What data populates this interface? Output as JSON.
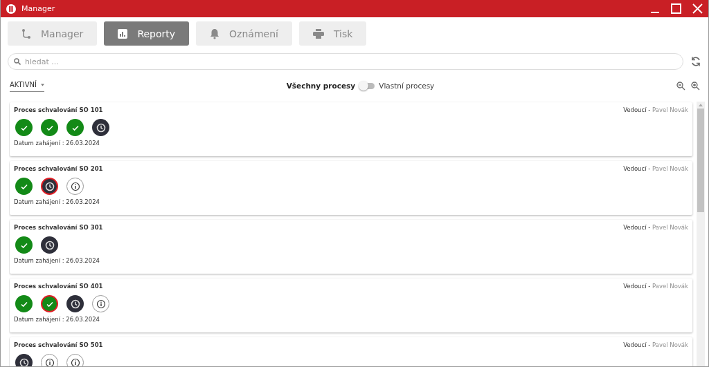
{
  "window": {
    "title": "Manager"
  },
  "tabs": [
    {
      "label": "Manager",
      "selected": false
    },
    {
      "label": "Reporty",
      "selected": true
    },
    {
      "label": "Oznámení",
      "selected": false
    },
    {
      "label": "Tisk",
      "selected": false
    }
  ],
  "search": {
    "placeholder": "hledat ..."
  },
  "filter": {
    "value": "AKTIVNÍ"
  },
  "scope_toggle": {
    "left_label": "Všechny procesy",
    "right_label": "Vlastní procesy",
    "on": false
  },
  "processes": [
    {
      "title": "Proces schvalování SO 101",
      "role": "Vedoucí - ",
      "person": "Pavel Novák",
      "date": "Datum zahájení : 26.03.2024",
      "steps": [
        {
          "kind": "done"
        },
        {
          "kind": "done"
        },
        {
          "kind": "done"
        },
        {
          "kind": "pending"
        }
      ]
    },
    {
      "title": "Proces schvalování SO 201",
      "role": "Vedoucí - ",
      "person": "Pavel Novák",
      "date": "Datum zahájení : 26.03.2024",
      "steps": [
        {
          "kind": "done"
        },
        {
          "kind": "pending-alert"
        },
        {
          "kind": "info"
        }
      ]
    },
    {
      "title": "Proces schvalování SO 301",
      "role": "Vedoucí - ",
      "person": "Pavel Novák",
      "date": "Datum zahájení : 26.03.2024",
      "steps": [
        {
          "kind": "done"
        },
        {
          "kind": "pending"
        }
      ]
    },
    {
      "title": "Proces schvalování SO 401",
      "role": "Vedoucí - ",
      "person": "Pavel Novák",
      "date": "Datum zahájení : 26.03.2024",
      "steps": [
        {
          "kind": "done"
        },
        {
          "kind": "done-alert"
        },
        {
          "kind": "pending"
        },
        {
          "kind": "info"
        }
      ]
    },
    {
      "title": "Proces schvalování SO 501",
      "role": "Vedoucí - ",
      "person": "Pavel Novák",
      "steps": [
        {
          "kind": "pending"
        },
        {
          "kind": "info"
        },
        {
          "kind": "info"
        }
      ]
    }
  ]
}
